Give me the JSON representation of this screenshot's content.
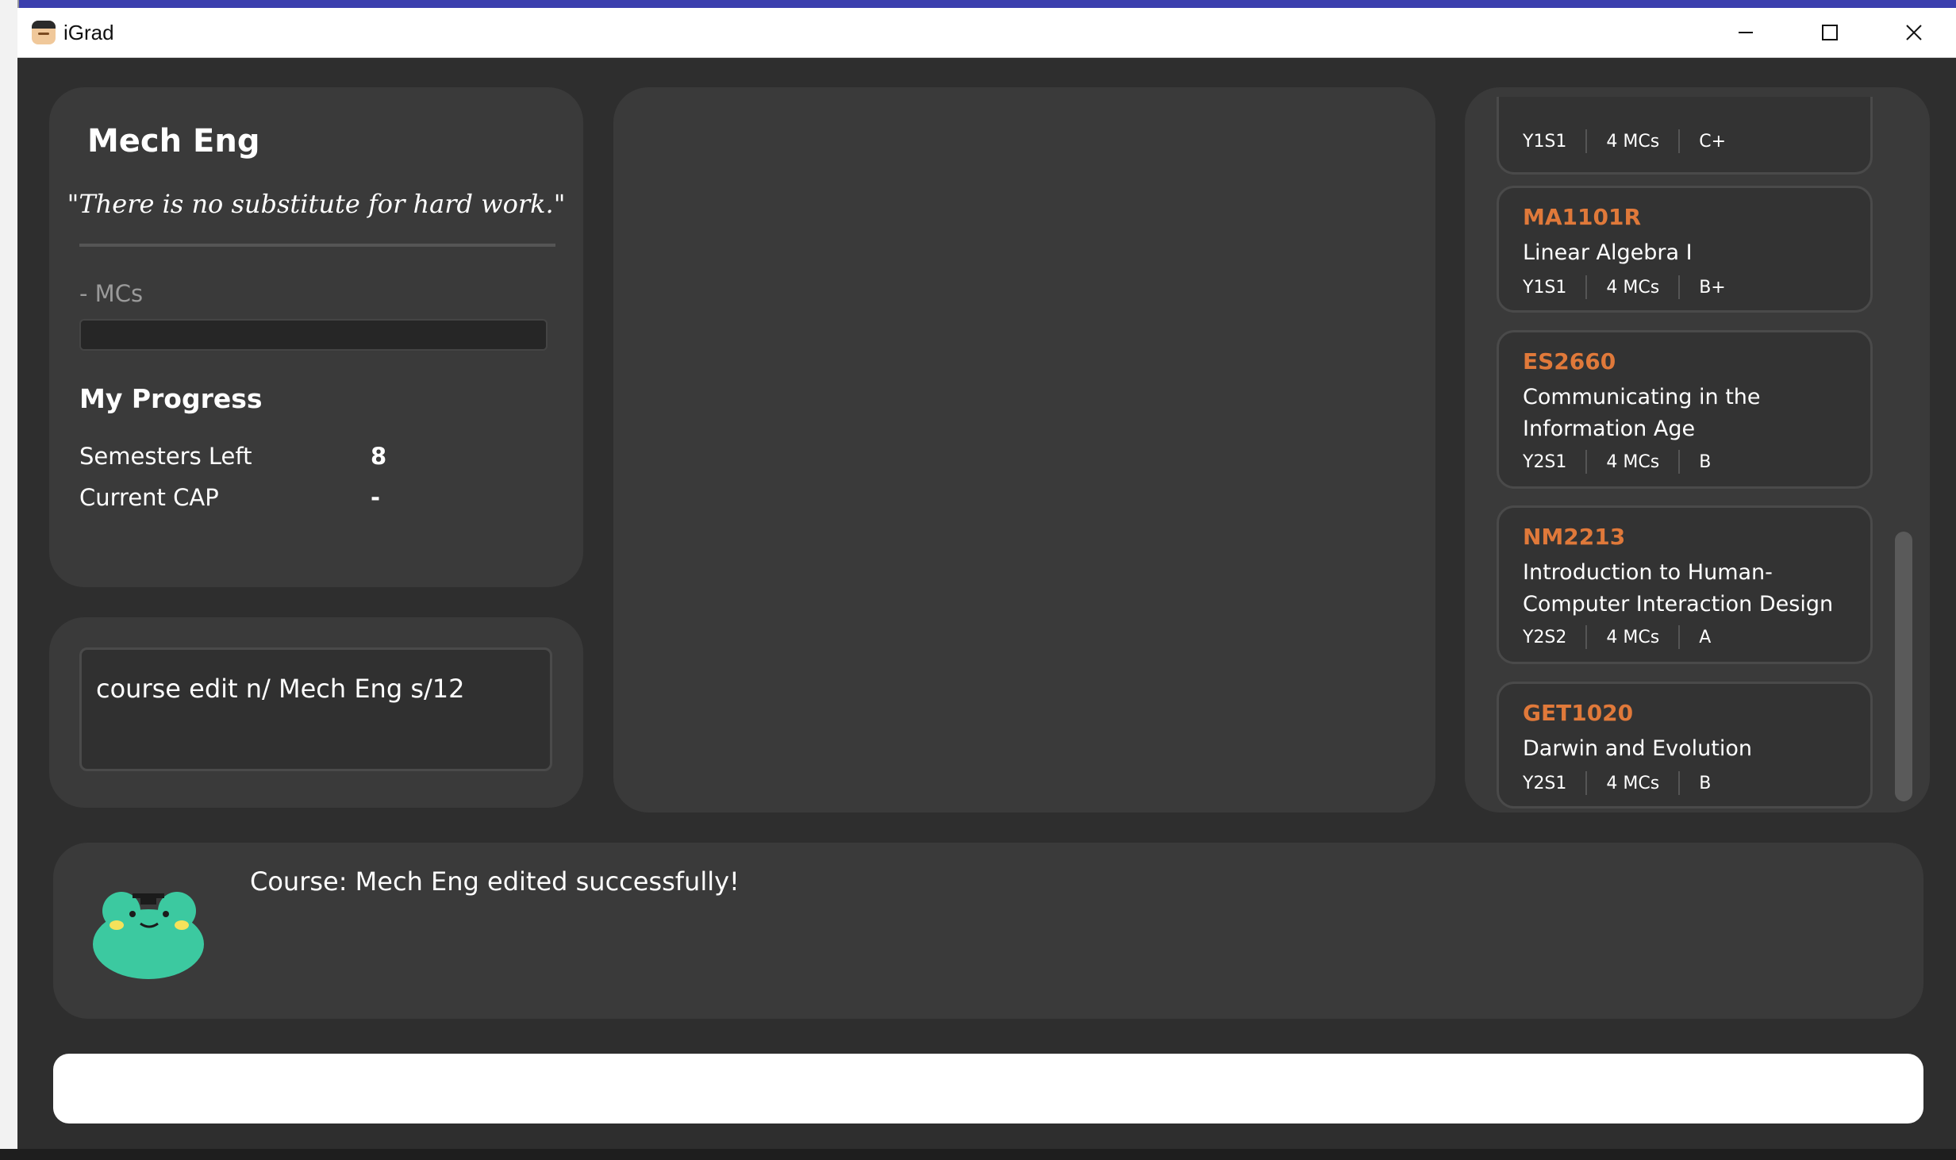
{
  "window": {
    "title": "iGrad"
  },
  "course": {
    "name": "Mech Eng",
    "quote": "\"There is no substitute for hard work.\"",
    "mcs_label": "- MCs",
    "mcs_progress": 0
  },
  "progress": {
    "title": "My Progress",
    "stats": [
      {
        "label": "Semesters Left",
        "value": "8"
      },
      {
        "label": "Current CAP",
        "value": "-"
      }
    ]
  },
  "command_box": {
    "text": "course edit n/ Mech Eng s/12"
  },
  "modules": [
    {
      "code": "",
      "title": "",
      "semester": "Y1S1",
      "mcs": "4 MCs",
      "grade": "C+"
    },
    {
      "code": "MA1101R",
      "title": "Linear Algebra I",
      "semester": "Y1S1",
      "mcs": "4 MCs",
      "grade": "B+"
    },
    {
      "code": "ES2660",
      "title": "Communicating in the Information Age",
      "semester": "Y2S1",
      "mcs": "4 MCs",
      "grade": "B"
    },
    {
      "code": "NM2213",
      "title": "Introduction to Human-Computer Interaction Design",
      "semester": "Y2S2",
      "mcs": "4 MCs",
      "grade": "A"
    },
    {
      "code": "GET1020",
      "title": "Darwin and Evolution",
      "semester": "Y2S1",
      "mcs": "4 MCs",
      "grade": "B"
    }
  ],
  "result": {
    "message": "Course: Mech Eng edited successfully!"
  },
  "colors": {
    "accent": "#e0793a",
    "panel": "#3a3a3a",
    "background": "#2e2e2e"
  },
  "icons": [
    "app-logo-icon",
    "minimize-icon",
    "maximize-icon",
    "close-icon",
    "frog-mascot-icon"
  ]
}
